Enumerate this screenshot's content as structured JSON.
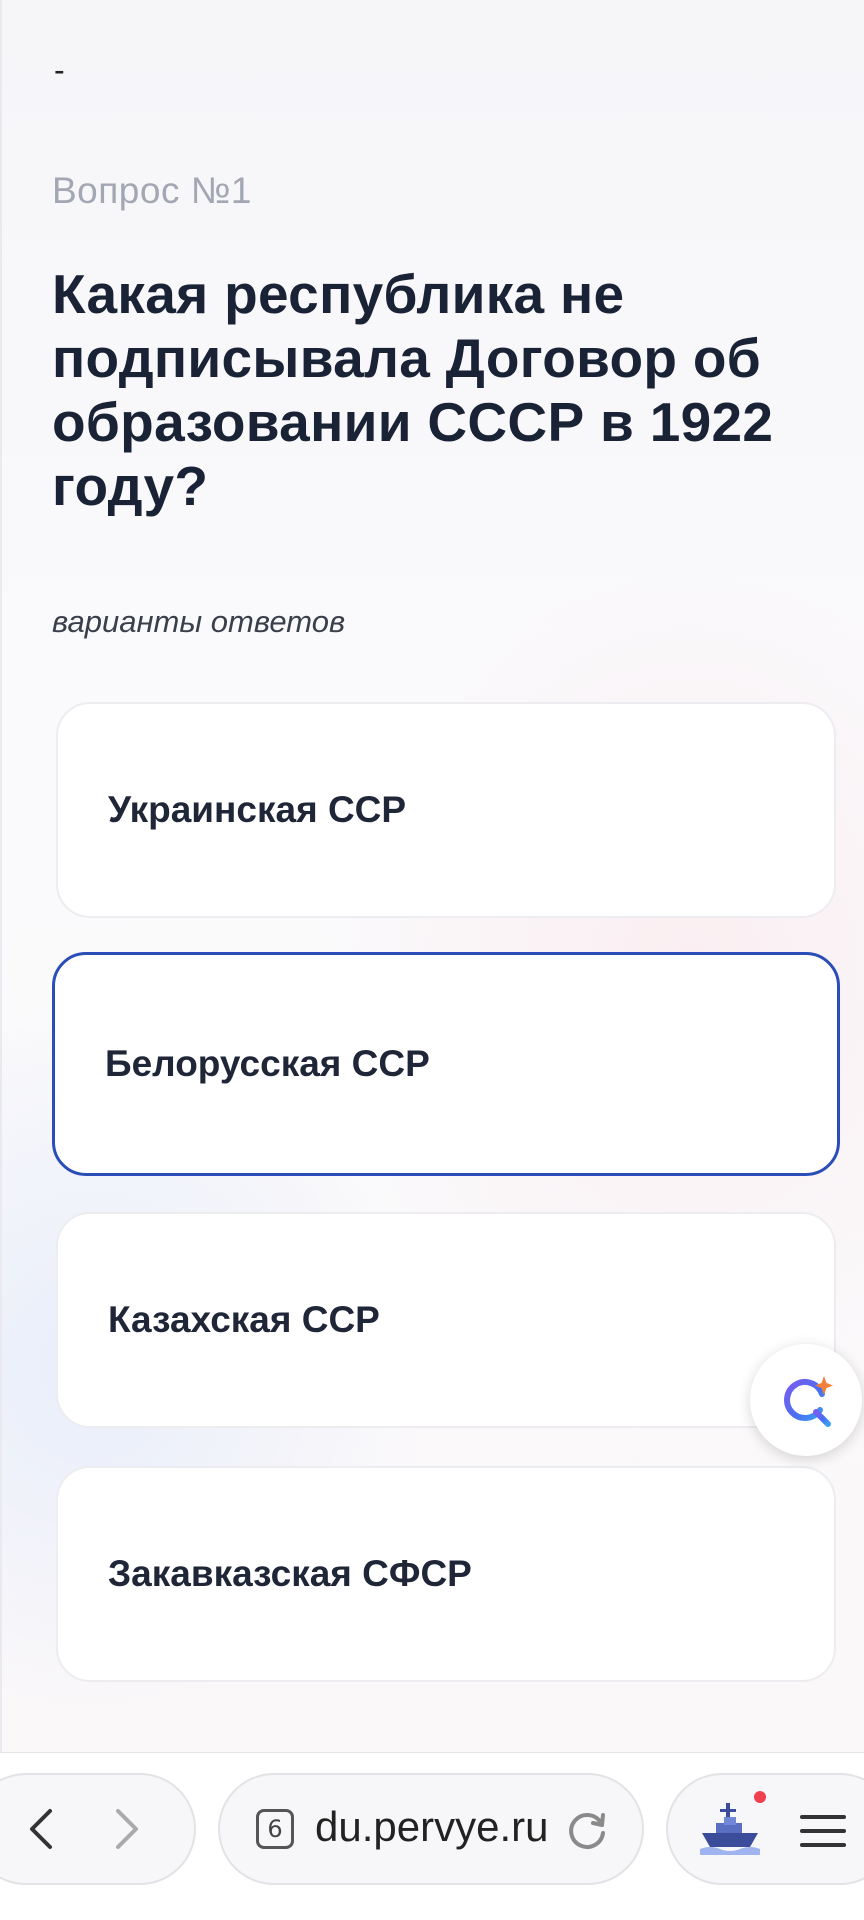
{
  "header": {
    "dash": "-",
    "question_number": "Вопрос №1",
    "question_text": "Какая республика не подписывала Договор об образовании СССР в 1922 году?",
    "answers_label": "варианты ответов"
  },
  "answers": [
    {
      "label": "Украинская ССР",
      "selected": false
    },
    {
      "label": "Белорусская ССР",
      "selected": true
    },
    {
      "label": "Казахская ССР",
      "selected": false
    },
    {
      "label": "Закавказская СФСР",
      "selected": false
    }
  ],
  "assistant_button": {
    "icon": "assistant-icon"
  },
  "browser": {
    "url": "du.pervye.ru",
    "tab_count": "6",
    "icons": [
      "back-arrow-icon",
      "forward-arrow-icon",
      "tab-count-icon",
      "reload-icon",
      "ship-extension-icon",
      "menu-icon"
    ]
  },
  "colors": {
    "text_dark": "#1a2235",
    "muted": "#a3a7b3",
    "selected_border": "#2a4db8",
    "notification": "#f04050"
  }
}
